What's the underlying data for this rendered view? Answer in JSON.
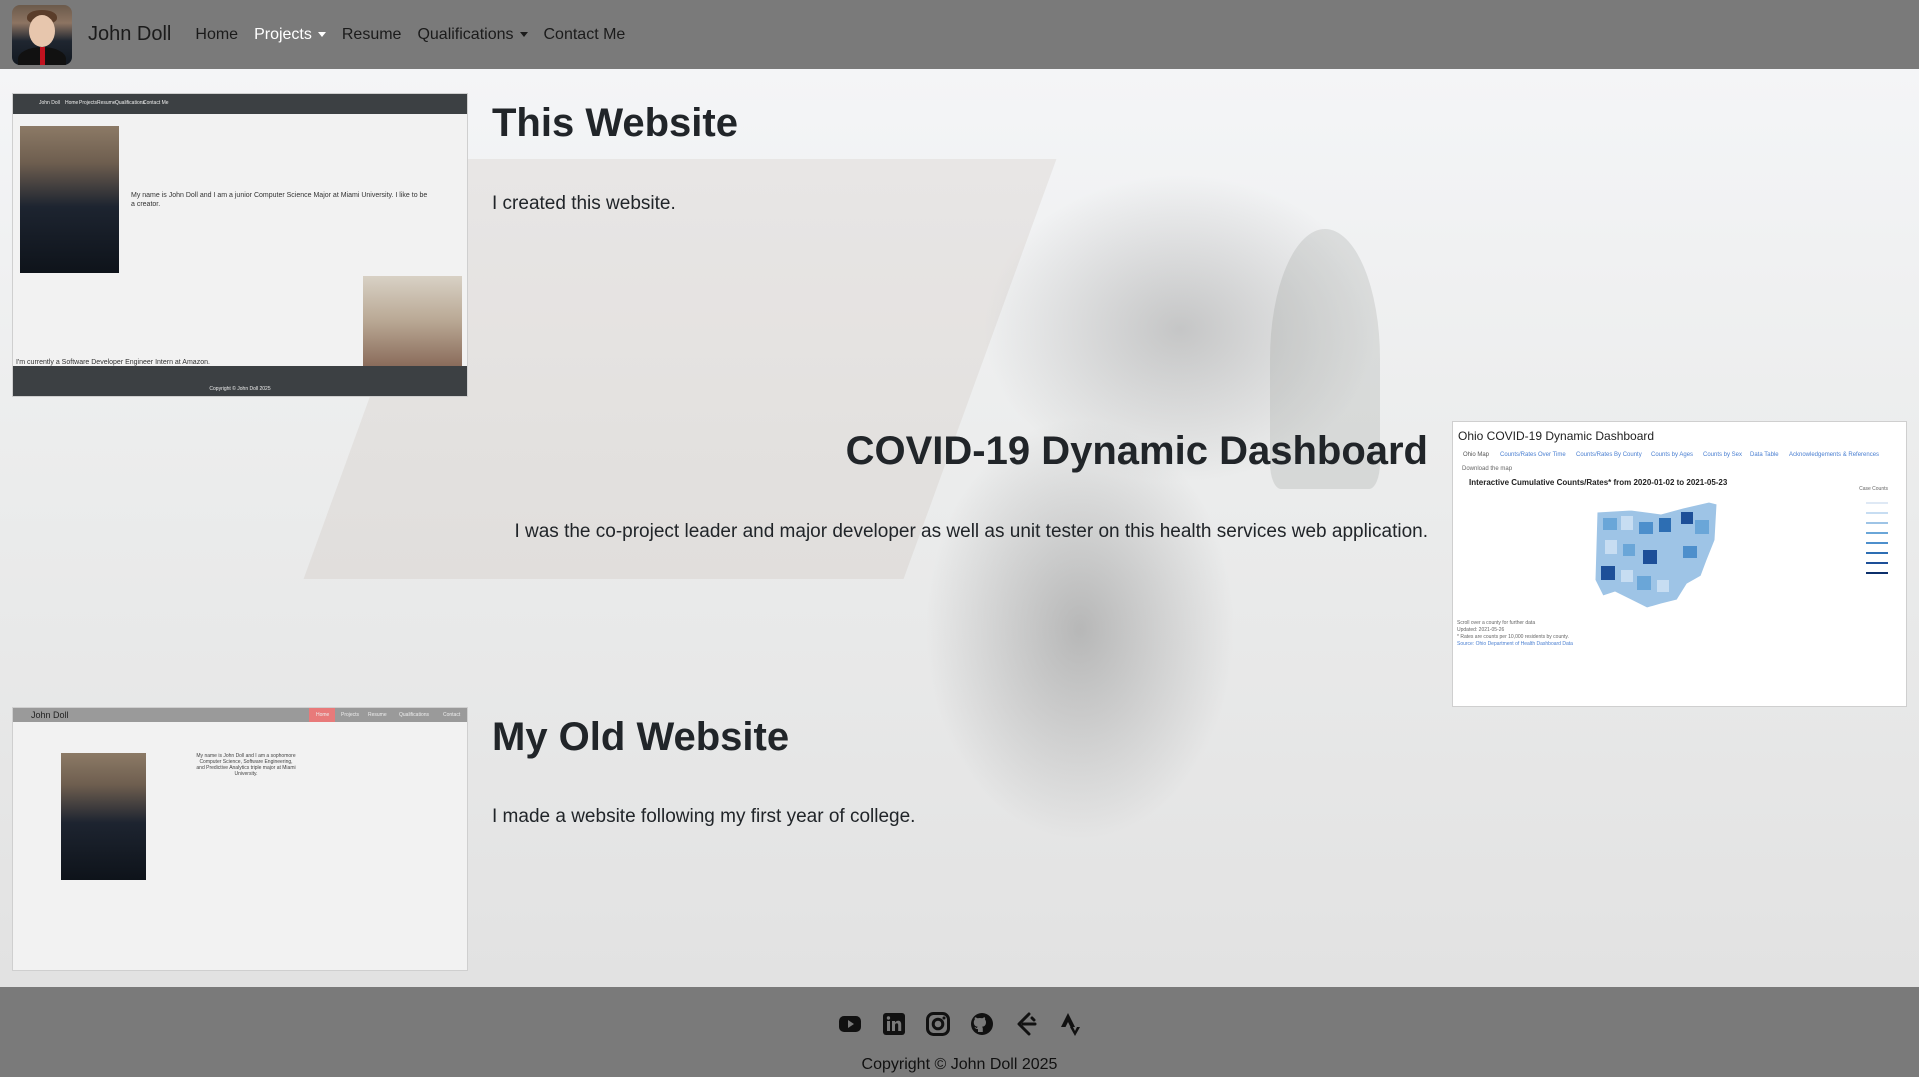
{
  "navbar": {
    "brand": "John Doll",
    "links": [
      {
        "label": "Home",
        "dropdown": false,
        "active": false
      },
      {
        "label": "Projects",
        "dropdown": true,
        "active": true
      },
      {
        "label": "Resume",
        "dropdown": false,
        "active": false
      },
      {
        "label": "Qualifications",
        "dropdown": true,
        "active": false
      },
      {
        "label": "Contact Me",
        "dropdown": false,
        "active": false
      }
    ]
  },
  "projects": [
    {
      "title": "This Website",
      "description": "I created this website.",
      "thumb": {
        "nav_brand": "John Doll",
        "nav_links": [
          "Home",
          "Projects",
          "Resume",
          "Qualifications",
          "Contact Me"
        ],
        "intro": "My name is John Doll and I am a junior Computer Science Major at Miami University. I like to be a creator.",
        "intern": "I'm currently a Software Developer Engineer Intern at Amazon.",
        "copyright": "Copyright © John Doll 2025"
      }
    },
    {
      "title": "COVID-19 Dynamic Dashboard",
      "description": "I was the co-project leader and major developer as well as unit tester on this health services web application.",
      "thumb": {
        "title": "Ohio COVID-19 Dynamic Dashboard",
        "tabs": [
          "Ohio Map",
          "Counts/Rates Over Time",
          "Counts/Rates By County",
          "Counts by Ages",
          "Counts by Sex",
          "Data Table",
          "Acknowledgements & References"
        ],
        "download": "Download the map",
        "heading": "Interactive Cumulative Counts/Rates* from 2020-01-02 to 2021-05-23",
        "legend_title": "Case Counts",
        "notes": [
          "Scroll over a county for further data",
          "Updated: 2021-05-26",
          "* Rates are counts per 10,000 residents by county.",
          "Source: Ohio Department of Health Dashboard Data"
        ]
      }
    },
    {
      "title": "My Old Website",
      "description": "I made a website following my first year of college.",
      "thumb": {
        "nav_brand": "John Doll",
        "nav_links": [
          "Home",
          "Projects",
          "Resume",
          "Qualifications",
          "Contact"
        ],
        "intro": "My name is John Doll and I am a sophomore Computer Science, Software Engineering, and Predictive Analytics triple major at Miami University."
      }
    }
  ],
  "footer": {
    "icons": [
      "youtube-icon",
      "linkedin-icon",
      "instagram-icon",
      "github-icon",
      "leetcode-icon",
      "strava-icon"
    ],
    "copyright": "Copyright © John Doll 2025"
  }
}
